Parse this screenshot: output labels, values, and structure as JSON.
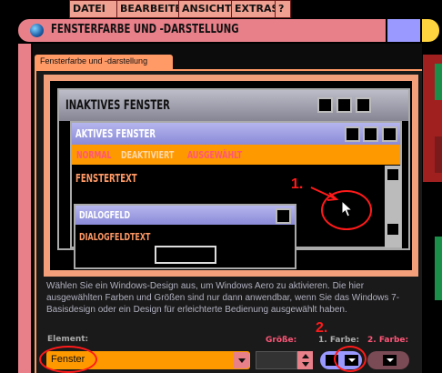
{
  "menu": {
    "items": [
      "DATEI",
      "BEARBEITEN",
      "ANSICHT",
      "EXTRAS",
      "?"
    ]
  },
  "window": {
    "title": "FENSTERFARBE UND -DARSTELLUNG"
  },
  "tab": {
    "label": "Fensterfarbe und -darstellung"
  },
  "preview": {
    "inactive_title": "INAKTIVES FENSTER",
    "active_title": "AKTIVES FENSTER",
    "menu_normal": "NORMAL",
    "menu_disabled": "DEAKTIVIERT",
    "menu_selected": "AUSGEWÄHLT",
    "window_text": "FENSTERTEXT",
    "dialog_title": "DIALOGFELD",
    "dialog_text": "DIALOGFELDTEXT"
  },
  "info_text": "Wählen Sie ein Windows-Design aus, um Windows Aero zu aktivieren. Die hier ausgewählten Farben und Größen sind nur dann anwendbar, wenn Sie das Windows 7-Basisdesign oder ein Design für erleichterte Bedienung ausgewählt haben.",
  "labels": {
    "element": "Element:",
    "size": "Größe:",
    "color1": "1. Farbe:",
    "color2": "2. Farbe:"
  },
  "fields": {
    "element_value": "Fenster",
    "size_value": ""
  },
  "annotations": {
    "step1": "1.",
    "step2": "2."
  },
  "colors": {
    "lcars_orange": "#ff9900",
    "lcars_salmon": "#e8808a",
    "lcars_lavender": "#9999ff",
    "lcars_peach": "#ff9966",
    "annotation_red": "#ff1a1a",
    "info_text": "#b0b0c0"
  }
}
